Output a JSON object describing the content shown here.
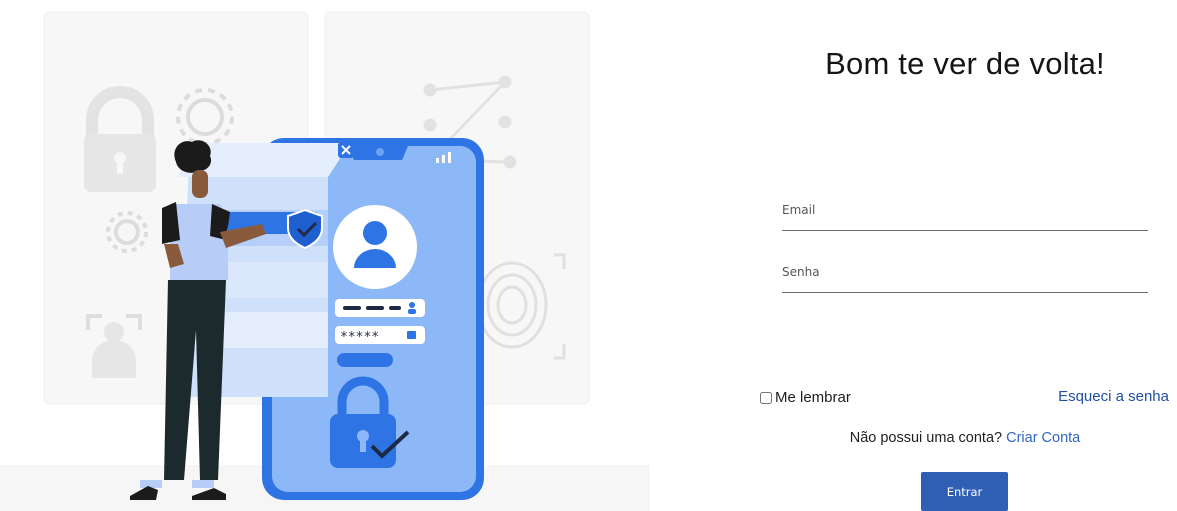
{
  "login": {
    "title": "Bom te ver de volta!",
    "email_placeholder": "Email",
    "password_placeholder": "Senha",
    "remember_label": "Me lembrar",
    "forgot_label": "Esqueci a senha",
    "signup_prompt": "Não possui uma conta?",
    "signup_link": "Criar Conta",
    "submit_label": "Entrar"
  },
  "colors": {
    "accent": "#2f5fb3",
    "link": "#1f4fa8",
    "illustration_blue": "#3c86ee",
    "illustration_light": "#b8d3fb"
  },
  "illustration": {
    "password_mask": "*****",
    "icons": [
      "padlock-icon",
      "gear-icon",
      "user-icon",
      "fingerprint-icon",
      "shield-check-icon",
      "close-icon",
      "signal-icon"
    ]
  }
}
